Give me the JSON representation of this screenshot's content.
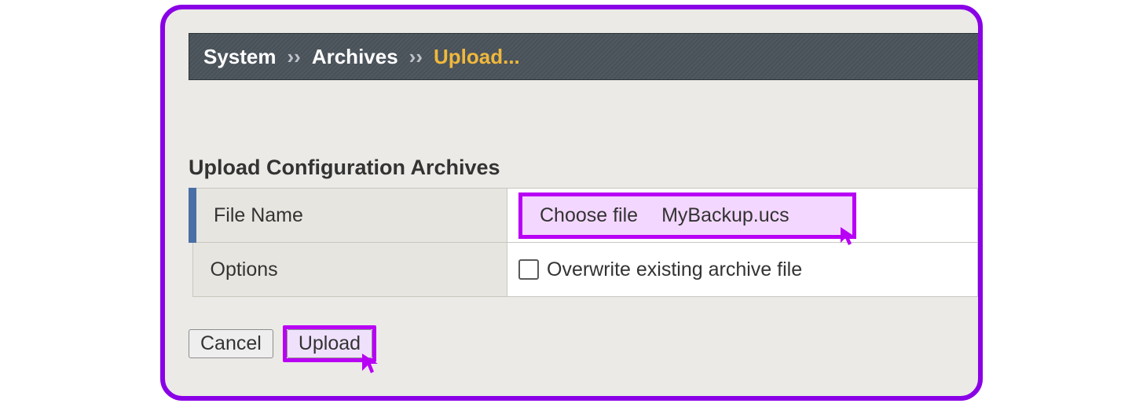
{
  "breadcrumb": {
    "part1": "System",
    "sep": "››",
    "part2": "Archives",
    "current": "Upload..."
  },
  "section": {
    "title": "Upload Configuration Archives"
  },
  "form": {
    "fileName": {
      "label": "File Name",
      "chooseLabel": "Choose file",
      "fileValue": "MyBackup.ucs"
    },
    "options": {
      "label": "Options",
      "overwriteLabel": "Overwrite existing archive file"
    }
  },
  "actions": {
    "cancel": "Cancel",
    "upload": "Upload"
  }
}
